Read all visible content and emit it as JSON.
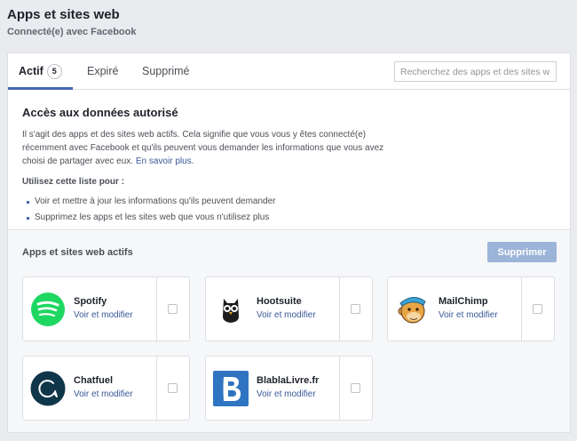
{
  "header": {
    "title": "Apps et sites web",
    "subtitle": "Connecté(e) avec Facebook"
  },
  "tabs": [
    {
      "label": "Actif",
      "badge": "5"
    },
    {
      "label": "Expiré"
    },
    {
      "label": "Supprimé"
    }
  ],
  "search": {
    "placeholder": "Recherchez des apps et des sites w"
  },
  "info": {
    "heading": "Accès aux données autorisé",
    "description": "Il s'agit des apps et des sites web actifs. Cela signifie que vous vous y êtes connecté(e) récemment avec Facebook et qu'ils peuvent vous demander les informations que vous avez choisi de partager avec eux.",
    "learn_more": "En savoir plus.",
    "list_title": "Utilisez cette liste pour :",
    "list_items": [
      "Voir et mettre à jour les informations qu'ils peuvent demander",
      "Supprimez les apps et les sites web que vous n'utilisez plus"
    ]
  },
  "apps_section": {
    "title": "Apps et sites web actifs",
    "delete_label": "Supprimer",
    "apps": [
      {
        "name": "Spotify",
        "edit": "Voir et modifier",
        "icon": "spotify-icon",
        "color": "#1ed760"
      },
      {
        "name": "Hootsuite",
        "edit": "Voir et modifier",
        "icon": "hootsuite-owl-icon",
        "color": "#1c1c1c"
      },
      {
        "name": "MailChimp",
        "edit": "Voir et modifier",
        "icon": "mailchimp-monkey-icon",
        "color": "#e7a545"
      },
      {
        "name": "Chatfuel",
        "edit": "Voir et modifier",
        "icon": "chatfuel-icon",
        "color": "#10364a"
      },
      {
        "name": "BlablaLivre.fr",
        "edit": "Voir et modifier",
        "icon": "blablalivre-b-icon",
        "color": "#2f74c0"
      }
    ]
  },
  "colors": {
    "accent": "#4267b2",
    "link": "#385898",
    "disabled_button": "#9cb4d8"
  }
}
